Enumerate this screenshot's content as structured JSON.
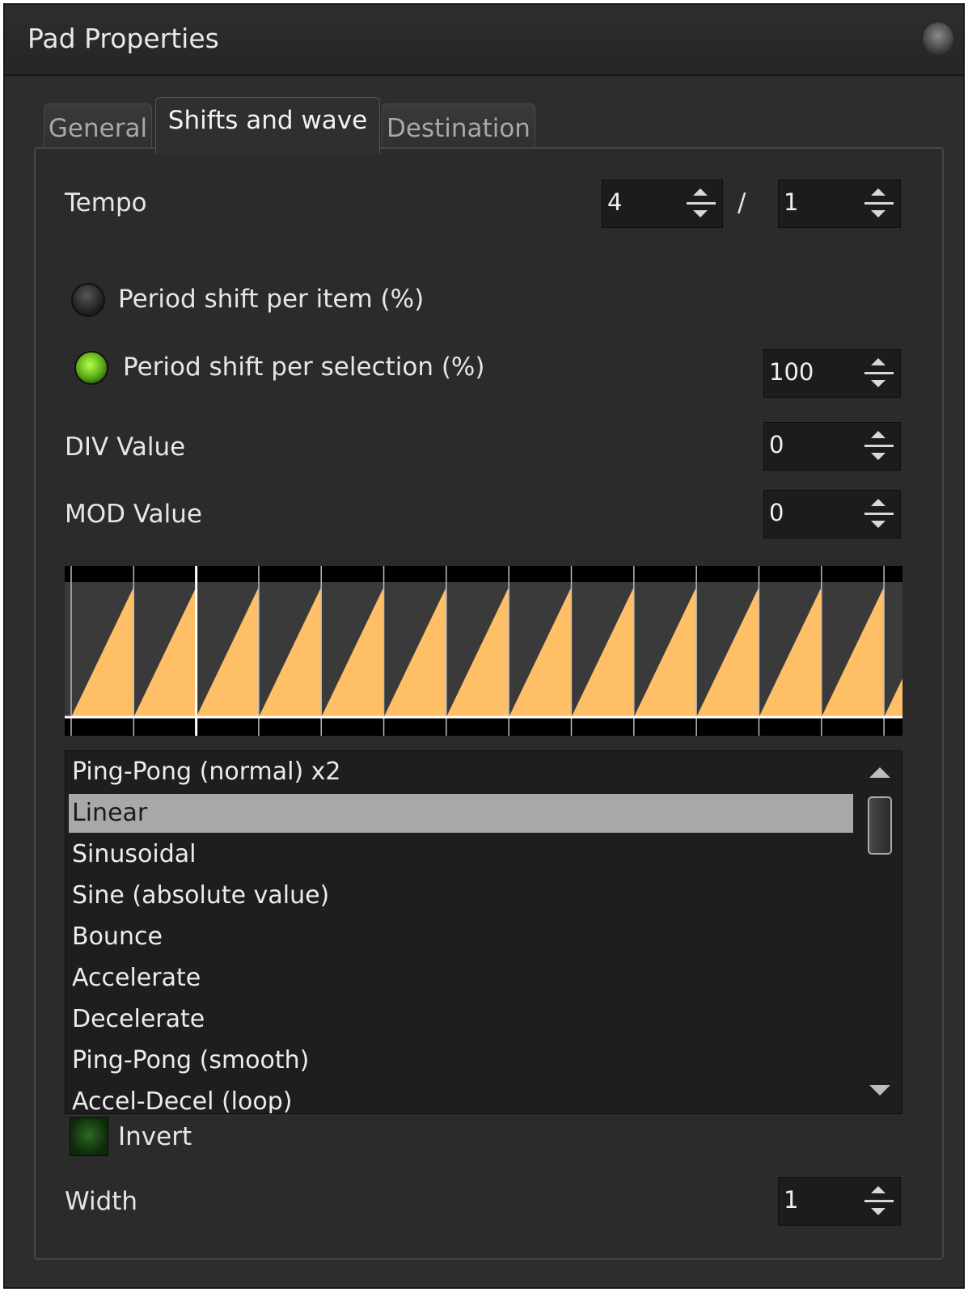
{
  "window": {
    "title": "Pad Properties"
  },
  "tabs": [
    {
      "label": "General",
      "active": false
    },
    {
      "label": "Shifts and wave",
      "active": true
    },
    {
      "label": "Destination",
      "active": false
    }
  ],
  "tempo": {
    "label": "Tempo",
    "numerator": "4",
    "separator": "/",
    "denominator": "1"
  },
  "period_shift_item": {
    "label": "Period shift per item (%)",
    "selected": false
  },
  "period_shift_selection": {
    "label": "Period shift per selection (%)",
    "selected": true,
    "value": "100"
  },
  "div_value": {
    "label": "DIV Value",
    "value": "0"
  },
  "mod_value": {
    "label": "MOD Value",
    "value": "0"
  },
  "wave_preview": {
    "shape": "sawtooth",
    "fill_color": "#ffbf66",
    "background": "#3a3a3a",
    "teeth_visible": 13.4
  },
  "wave_list": {
    "items": [
      "Ping-Pong (normal) x2",
      "Linear",
      "Sinusoidal",
      "Sine (absolute value)",
      "Bounce",
      "Accelerate",
      "Decelerate",
      "Ping-Pong (smooth)",
      "Accel-Decel (loop)"
    ],
    "selected": "Linear"
  },
  "invert": {
    "label": "Invert",
    "checked": false
  },
  "width": {
    "label": "Width",
    "value": "1"
  },
  "colors": {
    "accent_green": "#7ed321",
    "wave_orange": "#ffbf66",
    "background": "#2d2d2d"
  }
}
